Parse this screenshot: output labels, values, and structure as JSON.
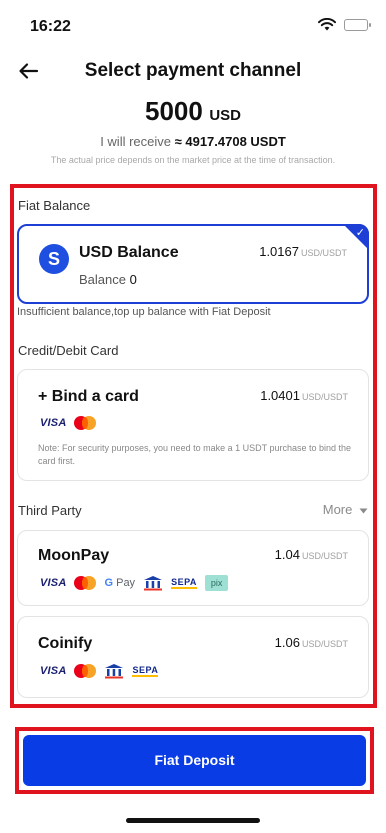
{
  "status_bar": {
    "time": "16:22"
  },
  "header": {
    "title": "Select payment channel"
  },
  "order": {
    "amount": "5000",
    "currency": "USD",
    "receive_prefix": "I will receive",
    "receive_value": "≈ 4917.4708 USDT",
    "price_note": "The actual price depends on the market price at the time of transaction."
  },
  "fiat_balance": {
    "section_label": "Fiat Balance",
    "card_title": "USD Balance",
    "logo_letter": "S",
    "rate": "1.0167",
    "rate_unit": "USD/USDT",
    "balance_label": "Balance",
    "balance_value": "0",
    "selected": true,
    "insufficient_note": "Insufficient balance,top up balance with Fiat Deposit"
  },
  "card_section": {
    "section_label": "Credit/Debit Card",
    "card_title": "+ Bind a card",
    "rate": "1.0401",
    "rate_unit": "USD/USDT",
    "logos": [
      "VISA",
      "mastercard"
    ],
    "note": "Note: For security purposes, you need to make a 1 USDT purchase to bind the card first."
  },
  "third_party": {
    "section_label": "Third Party",
    "more_label": "More",
    "providers": [
      {
        "name": "MoonPay",
        "rate": "1.04",
        "rate_unit": "USD/USDT",
        "logos": [
          "VISA",
          "mastercard",
          "G Pay",
          "bank",
          "SEPA",
          "pix"
        ]
      },
      {
        "name": "Coinify",
        "rate": "1.06",
        "rate_unit": "USD/USDT",
        "logos": [
          "VISA",
          "mastercard",
          "bank",
          "SEPA"
        ]
      }
    ]
  },
  "footer": {
    "button_label": "Fiat Deposit"
  },
  "colors": {
    "accent": "#0a3ce6",
    "highlight_frame": "#e0141e",
    "selected_border": "#1e3fd6"
  }
}
